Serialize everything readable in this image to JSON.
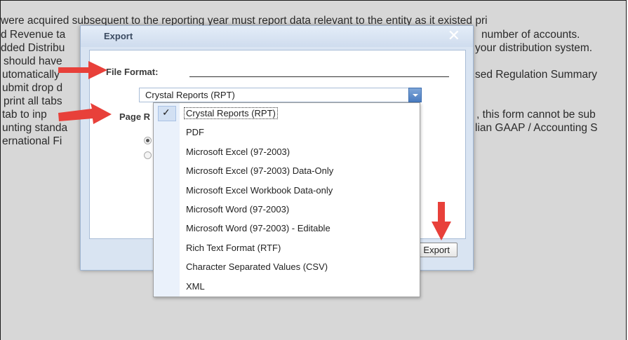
{
  "background_text": [
    "  were acquired subsequent to the reporting year must report data relevant to the entity as it existed pri",
    "d Revenue ta",
    "dded Distribu",
    "should have",
    "utomatically",
    "ubmit drop d",
    " print all tabs",
    "tab to inp",
    "unting standa",
    "ernational Fi"
  ],
  "background_text_right": [
    "number of accounts.",
    "your distribution system.",
    "sed Regulation Summary",
    ", this form cannot be sub",
    "lian GAAP / Accounting S"
  ],
  "dialog": {
    "title": "Export",
    "close_symbol": "✕",
    "file_format_label": "File Format:",
    "page_label": "Page R",
    "selected_format": "Crystal Reports (RPT)",
    "export_button": "Export"
  },
  "dropdown": {
    "check_symbol": "✓",
    "options": [
      "Crystal Reports (RPT)",
      "PDF",
      "Microsoft Excel (97-2003)",
      "Microsoft Excel (97-2003) Data-Only",
      "Microsoft Excel Workbook Data-only",
      "Microsoft Word (97-2003)",
      "Microsoft Word (97-2003) - Editable",
      "Rich Text Format (RTF)",
      "Character Separated Values (CSV)",
      "XML"
    ],
    "selected_index": 0
  },
  "colors": {
    "arrow_red": "#e8403a",
    "dialog_bg": "#d9e4f2",
    "select_trigger": "#4a7cc0"
  }
}
